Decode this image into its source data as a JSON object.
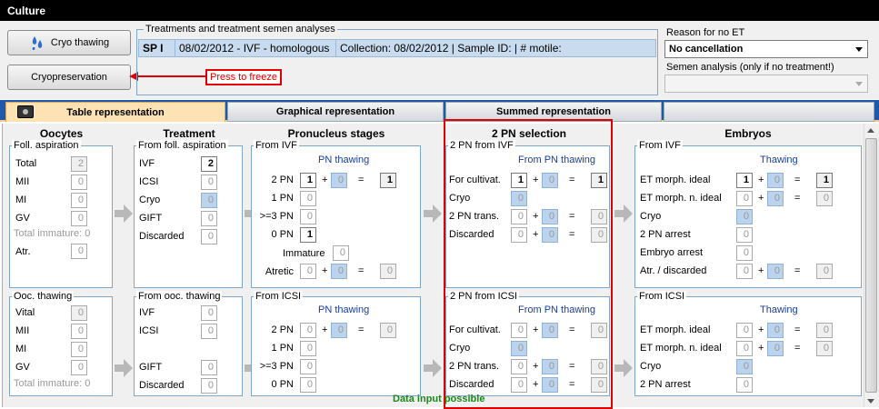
{
  "window": {
    "title": "Culture"
  },
  "buttons": {
    "thaw": "Cryo thawing",
    "cryo": "Cryopreservation",
    "press": "Press to freeze"
  },
  "treatments": {
    "legend": "Treatments and treatment semen analyses",
    "row": [
      "SP I",
      "08/02/2012 - IVF - homologous",
      "Collection: 08/02/2012 | Sample ID:  | # motile:"
    ]
  },
  "reason": {
    "label": "Reason for no ET",
    "value": "No cancellation"
  },
  "semen": {
    "label": "Semen analysis (only if no treatment!)",
    "value": ""
  },
  "tabs": [
    "Table representation",
    "Graphical representation",
    "Summed representation",
    ""
  ],
  "headers": {
    "oocytes": "Oocytes",
    "treatment": "Treatment",
    "pronucleus": "Pronucleus stages",
    "pn2": "2 PN selection",
    "embryos": "Embryos"
  },
  "oocytes": {
    "asp_legend": "Foll. aspiration",
    "asp_rows": [
      [
        "Total",
        "2"
      ],
      [
        "MII",
        "0"
      ],
      [
        "MI",
        "0"
      ],
      [
        "GV",
        "0"
      ]
    ],
    "asp_immature": "Total immature: 0",
    "asp_atr": [
      "Atr.",
      "0"
    ],
    "thaw_legend": "Ooc. thawing",
    "thaw_rows": [
      [
        "Vital",
        "0"
      ],
      [
        "MII",
        "0"
      ],
      [
        "MI",
        "0"
      ],
      [
        "GV",
        "0"
      ]
    ],
    "thaw_immature": "Total immature: 0"
  },
  "treatment": {
    "asp_legend": "From foll. aspiration",
    "asp_rows": [
      [
        "IVF",
        "2"
      ],
      [
        "ICSI",
        "0"
      ],
      [
        "Cryo",
        "0"
      ],
      [
        "GIFT",
        "0"
      ],
      [
        "Discarded",
        "0"
      ]
    ],
    "thaw_legend": "From ooc. thawing",
    "thaw_rows": [
      [
        "IVF",
        "0"
      ],
      [
        "ICSI",
        "0"
      ],
      [
        "GIFT",
        "0"
      ],
      [
        "Discarded",
        "0"
      ]
    ]
  },
  "pronucleus": {
    "ivf_legend": "From IVF",
    "sub": "PN thawing",
    "ivf_rows": [
      {
        "label": "2 PN",
        "a": "1",
        "b": "0",
        "c": "1"
      },
      {
        "label": "1 PN",
        "a": "0"
      },
      {
        "label": ">=3 PN",
        "a": "0"
      },
      {
        "label": "0 PN",
        "a": "1"
      }
    ],
    "immature": [
      "Immature",
      "0"
    ],
    "atretic": {
      "label": "Atretic",
      "a": "0",
      "b": "0",
      "c": "0"
    },
    "icsi_legend": "From ICSI",
    "icsi_rows": [
      {
        "label": "2 PN",
        "a": "0",
        "b": "0",
        "c": "0"
      },
      {
        "label": "1 PN",
        "a": "0"
      },
      {
        "label": ">=3 PN",
        "a": "0"
      },
      {
        "label": "0 PN",
        "a": "0"
      }
    ]
  },
  "pn2": {
    "ivf_legend": "2 PN from IVF",
    "sub": "From PN thawing",
    "ivf_rows": [
      {
        "label": "For cultivat.",
        "a": "1",
        "b": "0",
        "c": "1"
      },
      {
        "label": "Cryo",
        "a": "0"
      },
      {
        "label": "2 PN trans.",
        "a": "0",
        "b": "0",
        "c": "0"
      },
      {
        "label": "Discarded",
        "a": "0",
        "b": "0",
        "c": "0"
      }
    ],
    "icsi_legend": "2 PN from ICSI",
    "icsi_rows": [
      {
        "label": "For cultivat.",
        "a": "0",
        "b": "0",
        "c": "0"
      },
      {
        "label": "Cryo",
        "a": "0"
      },
      {
        "label": "2 PN trans.",
        "a": "0",
        "b": "0",
        "c": "0"
      },
      {
        "label": "Discarded",
        "a": "0",
        "b": "0",
        "c": "0"
      }
    ]
  },
  "embryos": {
    "ivf_legend": "From IVF",
    "sub": "Thawing",
    "ivf_rows": [
      {
        "label": "ET morph. ideal",
        "a": "1",
        "b": "0",
        "c": "1"
      },
      {
        "label": "ET morph. n. ideal",
        "a": "0",
        "b": "0",
        "c": "0"
      },
      {
        "label": "Cryo",
        "a": "0"
      },
      {
        "label": "2 PN arrest",
        "a": "0"
      },
      {
        "label": "Embryo arrest",
        "a": "0"
      },
      {
        "label": "Atr. / discarded",
        "a": "0",
        "b": "0",
        "c": "0"
      }
    ],
    "icsi_legend": "From ICSI",
    "icsi_rows": [
      {
        "label": "ET morph. ideal",
        "a": "0",
        "b": "0",
        "c": "0"
      },
      {
        "label": "ET morph. n. ideal",
        "a": "0",
        "b": "0",
        "c": "0"
      },
      {
        "label": "Cryo",
        "a": "0"
      },
      {
        "label": "2 PN arrest",
        "a": "0"
      }
    ]
  },
  "ops": {
    "plus": "+",
    "eq": "="
  },
  "status": "Data input possible",
  "colors": {
    "title_bg": "#000000",
    "tab_active": "#fde2b4",
    "tab_bar": "#1d59a8",
    "highlight": "#e00000",
    "status": "#1a8a1a",
    "cryo_field": "#bcd3ee"
  }
}
